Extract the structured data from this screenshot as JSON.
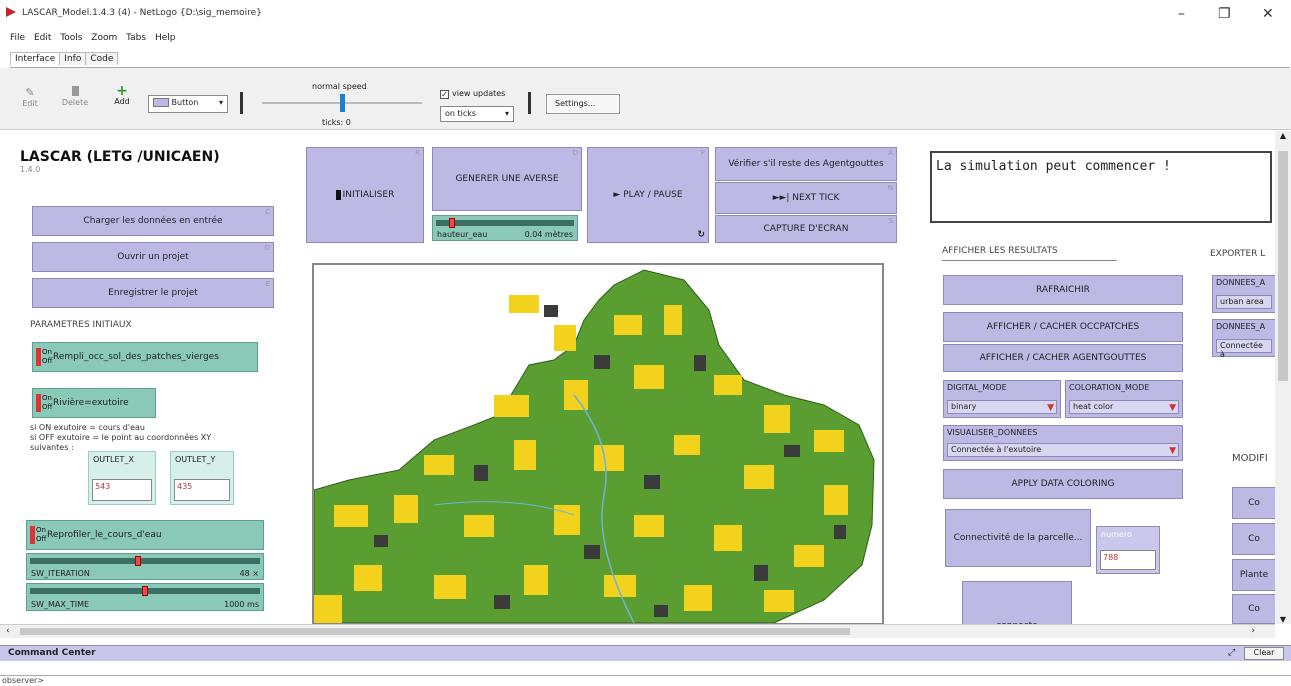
{
  "window": {
    "title": "LASCAR_Model.1.4.3 (4) - NetLogo {D:\\sig_memoire}",
    "minimize": "–",
    "maximize": "❐",
    "close": "✕"
  },
  "menu": [
    "File",
    "Edit",
    "Tools",
    "Zoom",
    "Tabs",
    "Help"
  ],
  "tabs": [
    "Interface",
    "Info",
    "Code"
  ],
  "toolbar": {
    "edit": "Edit",
    "delete": "Delete",
    "add": "Add",
    "widget_select": "Button",
    "speed_label": "normal speed",
    "ticks": "ticks: 0",
    "view_updates": "view updates",
    "update_mode": "on ticks",
    "settings": "Settings..."
  },
  "model": {
    "title": "LASCAR (LETG /UNICAEN)",
    "version": "1.4.0"
  },
  "left": {
    "load_data": "Charger les données en entrée",
    "open_project": "Ouvrir un projet",
    "save_project": "Enregistrer le projet",
    "params_header": "PARAMETRES INITIAUX",
    "switch1": "Rempli_occ_sol_des_patches_vierges",
    "switch2": "Rivière=exutoire",
    "note": "si ON exutoire = cours d'eau\nsi OFF exutoire = le point au coordonnées XY suivantes :",
    "outlet_x_label": "OUTLET_X",
    "outlet_x": "543",
    "outlet_y_label": "OUTLET_Y",
    "outlet_y": "435",
    "switch3": "Reprofiler_le_cours_d'eau",
    "sw_iteration_label": "SW_ITERATION",
    "sw_iteration": "48 ×",
    "sw_iteration_fraction": 0.47,
    "sw_max_time_label": "SW_MAX_TIME",
    "sw_max_time": "1000 ms",
    "sw_max_time_fraction": 0.5,
    "on": "On",
    "off": "Off"
  },
  "top_buttons": {
    "init": "INITIALISER",
    "init_key": "R",
    "rain": "GENERER UNE AVERSE",
    "rain_key": "D",
    "play": "► PLAY / PAUSE",
    "play_key": "P",
    "verify": "Vérifier s'il reste des Agentgouttes",
    "verify_key": "A",
    "next": "►►| NEXT TICK",
    "next_key": "N",
    "capture": "CAPTURE D'ECRAN",
    "capture_key": "S",
    "hauteur_label": "hauteur_eau",
    "hauteur_value": "0.04 mètres",
    "hauteur_fraction": 0.1
  },
  "output": "La simulation peut commencer !",
  "right": {
    "results_header": "AFFICHER LES RESULTATS",
    "refresh": "RAFRAICHIR",
    "toggle_occ": "AFFICHER / CACHER OCCPATCHES",
    "toggle_agents": "AFFICHER / CACHER AGENTGOUTTES",
    "digital_mode_label": "DIGITAL_MODE",
    "digital_mode": "binary",
    "coloration_label": "COLORATION_MODE",
    "coloration": "heat color",
    "visualiser_label": "VISUALISER_DONNEES",
    "visualiser": "Connectée à l'exutoire",
    "apply": "APPLY DATA COLORING",
    "connectivity": "Connectivité de la parcelle...",
    "numero_label": "numero",
    "numero": "788",
    "connecte": "connecte",
    "export_header": "EXPORTER L",
    "export1_label": "DONNEES_A",
    "export1": "urban area",
    "export2_label": "DONNEES_A",
    "export2": "Connectée à",
    "modif_header": "MODIFI",
    "side_btns": [
      "Co",
      "Co",
      "Plante",
      "Co"
    ]
  },
  "command": {
    "title": "Command Center",
    "clear": "Clear",
    "prompt": "observer>"
  },
  "colors": {
    "button": "#bcb9e4",
    "green_widget": "#8ac8b8",
    "map_green": "#5a9e32",
    "map_yellow": "#f2d21c",
    "map_dark": "#3b3b3b"
  }
}
